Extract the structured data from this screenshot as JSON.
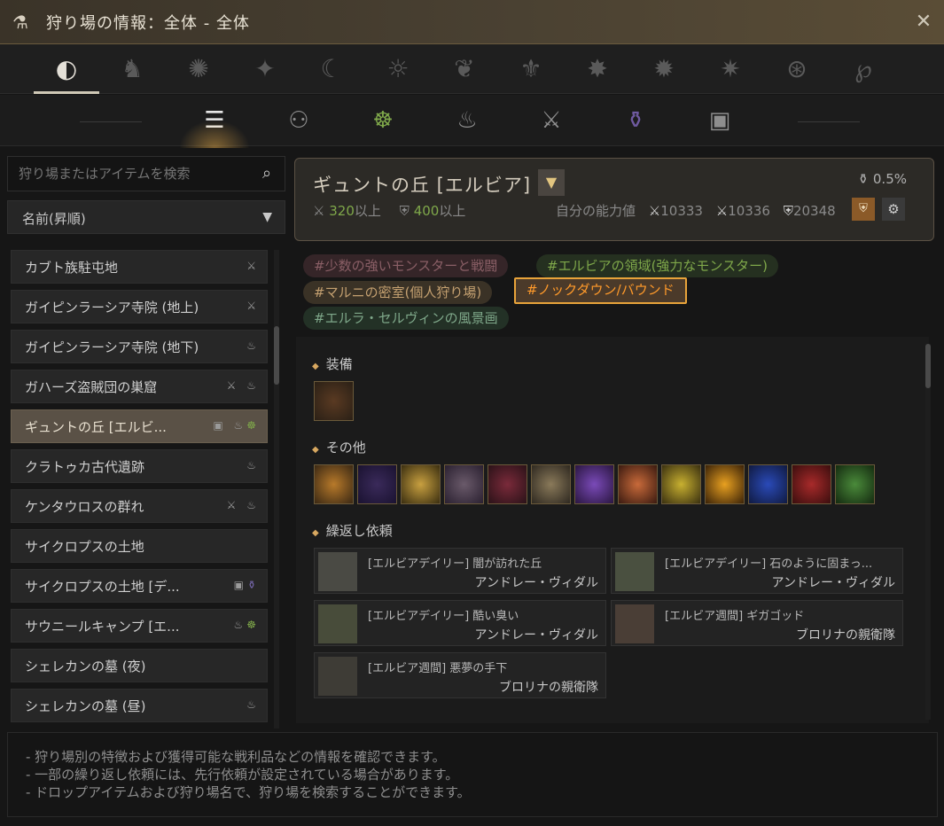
{
  "window": {
    "title": "狩り場の情報：全体 - 全体"
  },
  "search": {
    "placeholder": "狩り場またはアイテムを検索"
  },
  "sort": {
    "label": "名前(昇順)"
  },
  "zones": [
    {
      "name": "カブト族駐屯地",
      "icons": "⚔"
    },
    {
      "name": "ガイピンラーシア寺院 (地上)",
      "icons": "⚔"
    },
    {
      "name": "ガイピンラーシア寺院 (地下)",
      "icons": "♨"
    },
    {
      "name": "ガハーズ盗賊団の巣窟",
      "icons": "⚔ ♨"
    },
    {
      "name": "ギュントの丘 [エルビ...",
      "icons": "▣ ♨"
    },
    {
      "name": "クラトゥカ古代遺跡",
      "icons": "♨"
    },
    {
      "name": "ケンタウロスの群れ",
      "icons": "⚔ ♨"
    },
    {
      "name": "サイクロプスの土地",
      "icons": ""
    },
    {
      "name": "サイクロプスの土地 [デ...",
      "icons": "▣"
    },
    {
      "name": "サウニールキャンプ [エ...",
      "icons": "♨"
    },
    {
      "name": "シェレカンの墓 (夜)",
      "icons": ""
    },
    {
      "name": "シェレカンの墓 (昼)",
      "icons": "♨"
    }
  ],
  "zone_info": {
    "name": "ギュントの丘 [エルビア]",
    "req_ap": "320",
    "req_ap_unit": "以上",
    "req_dp": "400",
    "req_dp_unit": "以上",
    "my_stats_label": "自分の能力値",
    "my_ap": "10333",
    "my_aap": "10336",
    "my_dp": "20348",
    "drop_rate": "0.5%"
  },
  "tags": [
    "#少数の強いモンスターと戦闘",
    "#エルビアの領域(強力なモンスター)",
    "#マルニの密室(個人狩り場)",
    "#ノックダウン/バウンド",
    "#エルラ・セルヴィンの風景画"
  ],
  "sections": {
    "equipment": "装備",
    "other": "その他",
    "repeat": "繰返し依頼"
  },
  "quests": [
    {
      "title": "[エルビアデイリー] 闇が訪れた丘",
      "giver": "アンドレー・ヴィダル"
    },
    {
      "title": "[エルビアデイリー] 石のように固まっ...",
      "giver": "アンドレー・ヴィダル"
    },
    {
      "title": "[エルビアデイリー] 酷い臭い",
      "giver": "アンドレー・ヴィダル"
    },
    {
      "title": "[エルビア週間] ギガゴッド",
      "giver": "ブロリナの親衛隊"
    },
    {
      "title": "[エルビア週間] 悪夢の手下",
      "giver": "ブロリナの親衛隊"
    }
  ],
  "footer": [
    "- 狩り場別の特徴および獲得可能な戦利品などの情報を確認できます。",
    "- 一部の繰り返し依頼には、先行依頼が設定されている場合があります。",
    "- ドロップアイテムおよび狩り場名で、狩り場を検索することができます。"
  ],
  "colors": {
    "accent_gold": "#d8a860",
    "tag_selected": "#ff9a2a",
    "green": "#7fa84a"
  }
}
